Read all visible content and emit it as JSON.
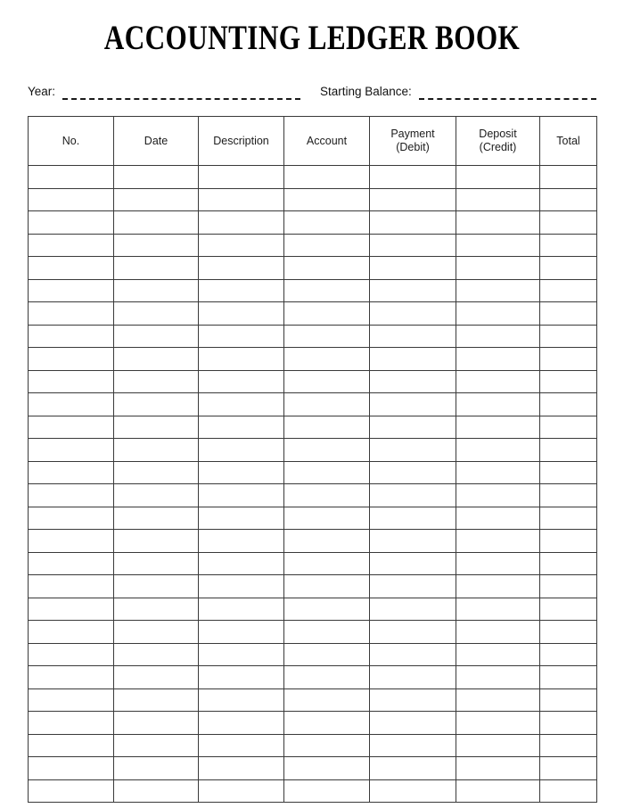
{
  "document": {
    "title": "ACCOUNTING LEDGER BOOK"
  },
  "meta": {
    "year": {
      "label": "Year:",
      "value": "",
      "placeholder": "",
      "dash_count": 10
    },
    "starting_balance": {
      "label": "Starting Balance:",
      "value": "",
      "placeholder": "",
      "dash_count": 7
    }
  },
  "table": {
    "columns": [
      {
        "key": "no",
        "label": "No.",
        "label_line1": "No.",
        "label_line2": ""
      },
      {
        "key": "date",
        "label": "Date",
        "label_line1": "Date",
        "label_line2": ""
      },
      {
        "key": "desc",
        "label": "Description",
        "label_line1": "Description",
        "label_line2": ""
      },
      {
        "key": "account",
        "label": "Account",
        "label_line1": "Account",
        "label_line2": ""
      },
      {
        "key": "payment",
        "label": "Payment (Debit)",
        "label_line1": "Payment",
        "label_line2": "(Debit)"
      },
      {
        "key": "deposit",
        "label": "Deposit (Credit)",
        "label_line1": "Deposit",
        "label_line2": "(Credit)"
      },
      {
        "key": "total",
        "label": "Total",
        "label_line1": "Total",
        "label_line2": ""
      }
    ],
    "row_count": 28,
    "rows": []
  },
  "colors": {
    "page_background": "#ffffff",
    "text": "#1a1a1a",
    "border": "#3a3a3a",
    "title": "#000000"
  }
}
